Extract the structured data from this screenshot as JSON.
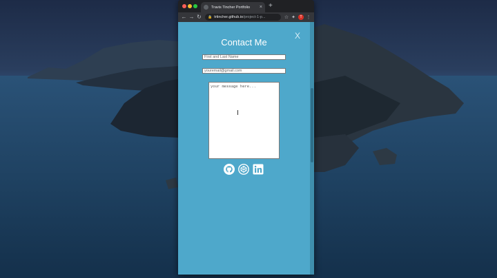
{
  "browser": {
    "tab_title": "Travis Tincher Portfolio",
    "tab_close": "×",
    "new_tab": "+",
    "nav": {
      "back": "←",
      "forward": "→",
      "reload": "↻"
    },
    "url_host": "trtincher.github.io",
    "url_path": "/project-1-p...",
    "lock": "🔒",
    "profile_initial": "T",
    "menu": "⋮",
    "star": "☆",
    "extensions": "✦"
  },
  "page": {
    "close_label": "X",
    "heading": "Contact Me",
    "name_placeholder": "First and Last Name",
    "email_placeholder": "youremail@gmail.com",
    "message_placeholder": "your message here...",
    "social": [
      "github-icon",
      "codepen-icon",
      "linkedin-icon"
    ]
  },
  "colors": {
    "page_bg": "#4ea8cb",
    "heading": "#ffffff",
    "browser_chrome": "#202124"
  }
}
